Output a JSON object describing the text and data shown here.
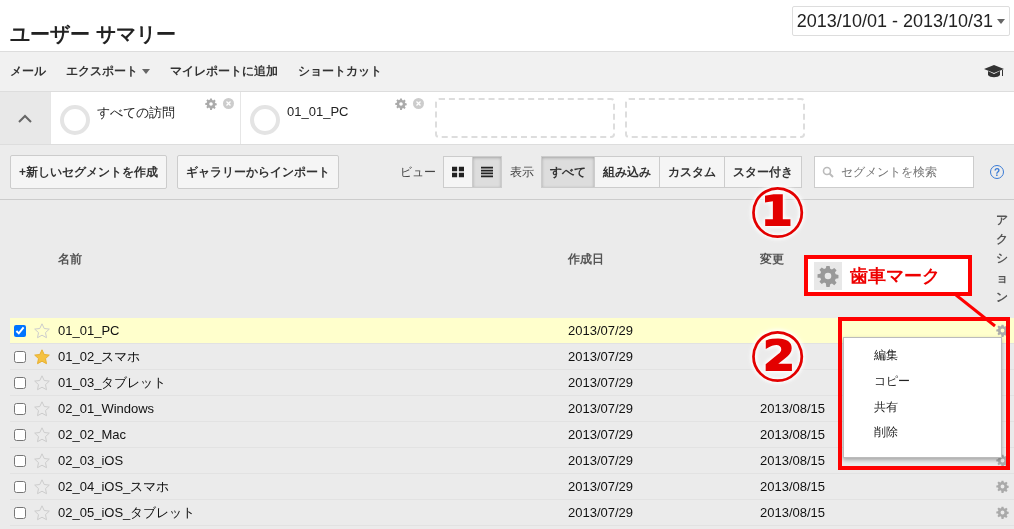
{
  "header": {
    "title": "ユーザー サマリー",
    "date_range": "2013/10/01 - 2013/10/31"
  },
  "toolbar": {
    "items": [
      {
        "label": "メール",
        "dropdown": false
      },
      {
        "label": "エクスポート",
        "dropdown": true
      },
      {
        "label": "マイレポートに追加",
        "dropdown": false
      },
      {
        "label": "ショートカット",
        "dropdown": false
      }
    ]
  },
  "segment_bar": {
    "expanded": true,
    "slots": [
      {
        "kind": "segment",
        "label": "すべての訪問"
      },
      {
        "kind": "segment",
        "label": "01_01_PC"
      },
      {
        "kind": "empty"
      },
      {
        "kind": "empty"
      }
    ]
  },
  "controls": {
    "buttons": [
      "+新しいセグメントを作成",
      "ギャラリーからインポート"
    ],
    "view_label": "ビュー",
    "views": [
      {
        "kind": "grid",
        "selected": false
      },
      {
        "kind": "list",
        "selected": true
      }
    ],
    "filter_label": "表示",
    "filters": [
      {
        "label": "すべて",
        "selected": true
      },
      {
        "label": "組み込み",
        "selected": false
      },
      {
        "label": "カスタム",
        "selected": false
      },
      {
        "label": "スター付き",
        "selected": false
      }
    ],
    "search": {
      "placeholder": "セグメントを検索"
    },
    "help": "?"
  },
  "table": {
    "columns": [
      "名前",
      "作成日",
      "変更",
      "アクション"
    ],
    "rows": [
      {
        "checked": true,
        "starred": false,
        "name": "01_01_PC",
        "created": "2013/07/29",
        "gear": true
      },
      {
        "checked": false,
        "starred": true,
        "name": "01_02_スマホ",
        "created": "2013/07/29",
        "gear": false
      },
      {
        "checked": false,
        "starred": false,
        "name": "01_03_タブレット",
        "created": "2013/07/29",
        "gear": false
      },
      {
        "checked": false,
        "starred": false,
        "name": "02_01_Windows",
        "created": "2013/07/29",
        "modified": "2013/08/15",
        "gear": false
      },
      {
        "checked": false,
        "starred": false,
        "name": "02_02_Mac",
        "created": "2013/07/29",
        "modified": "2013/08/15",
        "gear": false
      },
      {
        "checked": false,
        "starred": false,
        "name": "02_03_iOS",
        "created": "2013/07/29",
        "modified": "2013/08/15",
        "gear": true
      },
      {
        "checked": false,
        "starred": false,
        "name": "02_04_iOS_スマホ",
        "created": "2013/07/29",
        "modified": "2013/08/15",
        "gear": true
      },
      {
        "checked": false,
        "starred": false,
        "name": "02_05_iOS_タブレット",
        "created": "2013/07/29",
        "modified": "2013/08/15",
        "gear": true
      }
    ]
  },
  "action_menu": {
    "items": [
      "編集",
      "コピー",
      "共有",
      "削除"
    ]
  },
  "annotations": {
    "markers": [
      "①",
      "②"
    ],
    "callout": "歯車マーク"
  }
}
